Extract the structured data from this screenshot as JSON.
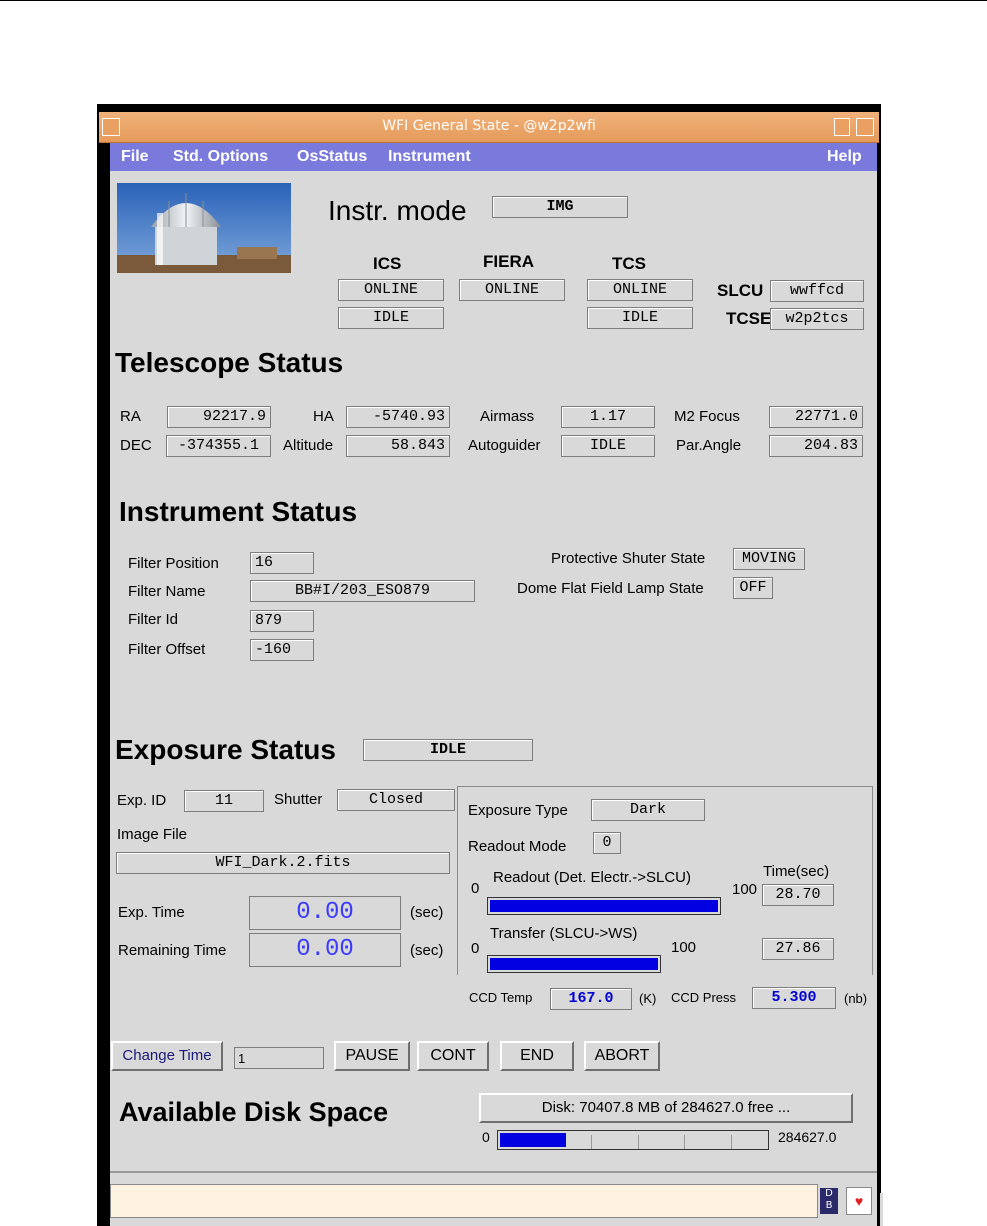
{
  "window": {
    "title": "WFI General State - @w2p2wfi"
  },
  "menu": {
    "file": "File",
    "std_options": "Std. Options",
    "os_status": "OsStatus",
    "instrument": "Instrument",
    "help": "Help"
  },
  "header": {
    "instr_mode_label": "Instr. mode",
    "instr_mode_value": "IMG",
    "ics_label": "ICS",
    "fiera_label": "FIERA",
    "tcs_label": "TCS",
    "ics_state": "ONLINE",
    "ics_sub": "IDLE",
    "fiera_state": "ONLINE",
    "tcs_state": "ONLINE",
    "tcs_sub": "IDLE",
    "slcu_label": "SLCU",
    "slcu_value": "wwffcd",
    "tcse_label": "TCSE",
    "tcse_value": "w2p2tcs"
  },
  "telescope": {
    "title": "Telescope Status",
    "ra_label": "RA",
    "ra": "92217.9",
    "ha_label": "HA",
    "ha": "-5740.93",
    "airmass_label": "Airmass",
    "airmass": "1.17",
    "m2focus_label": "M2 Focus",
    "m2focus": "22771.0",
    "dec_label": "DEC",
    "dec": "-374355.1",
    "altitude_label": "Altitude",
    "altitude": "58.843",
    "autoguider_label": "Autoguider",
    "autoguider": "IDLE",
    "parangle_label": "Par.Angle",
    "parangle": "204.83"
  },
  "instrument": {
    "title": "Instrument Status",
    "filter_position_label": "Filter Position",
    "filter_position": "16",
    "filter_name_label": "Filter Name",
    "filter_name": "BB#I/203_ESO879",
    "filter_id_label": "Filter Id",
    "filter_id": "879",
    "filter_offset_label": "Filter Offset",
    "filter_offset": "-160",
    "shutter_state_label": "Protective Shuter State",
    "shutter_state": "MOVING",
    "lamp_state_label": "Dome Flat Field Lamp State",
    "lamp_state": "OFF"
  },
  "exposure": {
    "title": "Exposure Status",
    "state": "IDLE",
    "exp_id_label": "Exp. ID",
    "exp_id": "11",
    "shutter_label": "Shutter",
    "shutter": "Closed",
    "image_file_label": "Image File",
    "image_file": "WFI_Dark.2.fits",
    "exp_time_label": "Exp. Time",
    "exp_time": "0.00",
    "remaining_label": "Remaining Time",
    "remaining": "0.00",
    "sec": "(sec)",
    "type_label": "Exposure Type",
    "type": "Dark",
    "readout_mode_label": "Readout Mode",
    "readout_mode": "0",
    "time_sec_label": "Time(sec)",
    "readout_label": "Readout (Det. Electr.->SLCU)",
    "readout_min": "0",
    "readout_max": "100",
    "readout_time": "28.70",
    "readout_progress": 1.0,
    "transfer_label": "Transfer (SLCU->WS)",
    "transfer_min": "0",
    "transfer_max": "100",
    "transfer_time": "27.86",
    "transfer_progress": 1.0,
    "ccd_temp_label": "CCD Temp",
    "ccd_temp": "167.0",
    "ccd_temp_unit": "(K)",
    "ccd_press_label": "CCD Press",
    "ccd_press": "5.300",
    "ccd_press_unit": "(nb)"
  },
  "controls": {
    "change_time": "Change Time",
    "time_input": "1",
    "pause": "PAUSE",
    "cont": "CONT",
    "end": "END",
    "abort": "ABORT"
  },
  "disk": {
    "title": "Available Disk Space",
    "summary": "Disk: 70407.8 MB of 284627.0 free ...",
    "min": "0",
    "max": "284627.0",
    "fraction": 0.247
  },
  "status_bar": {
    "db_icon": "db-icon",
    "heart_icon": "heart-icon"
  }
}
